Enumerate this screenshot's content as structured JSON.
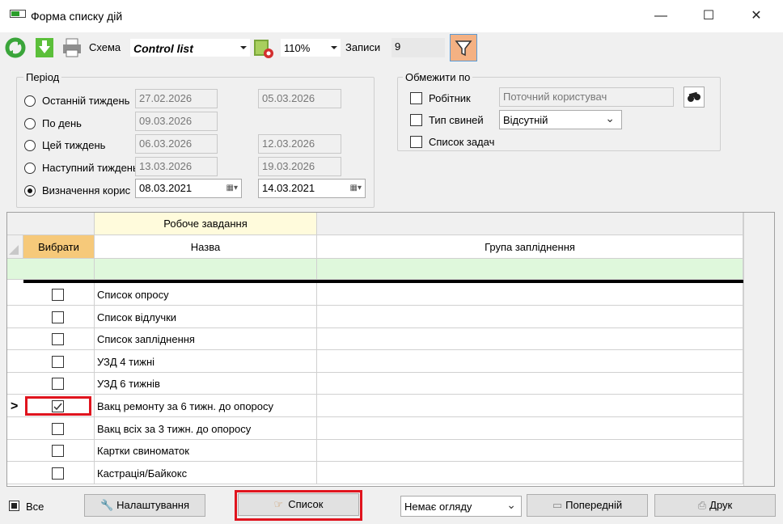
{
  "window": {
    "title": "Форма списку дій",
    "minimize": "—",
    "maximize": "☐",
    "close": "✕"
  },
  "toolbar": {
    "scheme_label": "Схема",
    "scheme_value": "Control list",
    "zoom_value": "110%",
    "records_label": "Записи",
    "records_value": "9",
    "icons": [
      "refresh-icon",
      "export-icon",
      "print-icon",
      "scheme-settings-icon",
      "filter-icon"
    ]
  },
  "period": {
    "title": "Період",
    "options": [
      {
        "label": "Останній тиждень",
        "from": "27.02.2026",
        "to": "05.03.2026",
        "selected": false
      },
      {
        "label": "По день",
        "from": "09.03.2026",
        "to": "",
        "selected": false
      },
      {
        "label": "Цей тиждень",
        "from": "06.03.2026",
        "to": "12.03.2026",
        "selected": false
      },
      {
        "label": "Наступний тиждень",
        "from": "13.03.2026",
        "to": "19.03.2026",
        "selected": false
      },
      {
        "label": "Визначення корис",
        "from": "08.03.2021",
        "to": "14.03.2021",
        "selected": true
      }
    ]
  },
  "limit": {
    "title": "Обмежити по",
    "worker_label": "Робітник",
    "worker_value": "Поточний користувач",
    "pig_type_label": "Тип свиней",
    "pig_type_value": "Відсутній",
    "task_list_label": "Список задач"
  },
  "grid": {
    "group_header": "Робоче завдання",
    "col_select": "Вибрати",
    "col_name": "Назва",
    "col_group": "Група запліднення",
    "current_row_marker": ">",
    "rows": [
      {
        "name": "Список опросу",
        "checked": false
      },
      {
        "name": "Список відлучки",
        "checked": false
      },
      {
        "name": "Список запліднення",
        "checked": false
      },
      {
        "name": "УЗД 4 тижні",
        "checked": false
      },
      {
        "name": "УЗД 6 тижнів",
        "checked": false
      },
      {
        "name": "Вакц ремонту за 6 тижн. до опоросу",
        "checked": true
      },
      {
        "name": "Вакц всіх за 3 тижн. до опоросу",
        "checked": false
      },
      {
        "name": "Картки свиноматок",
        "checked": false
      },
      {
        "name": "Кастрація/Байкокс",
        "checked": false
      }
    ]
  },
  "bottom": {
    "all_label": "Все",
    "settings_button": "Налаштування",
    "list_button": "Список",
    "view_select": "Немає огляду",
    "previous_button": "Попередній",
    "print_button": "Друк"
  },
  "colors": {
    "group_header_bg": "#fffbdc",
    "select_header_bg": "#f6c97a",
    "filter_row_bg": "#dff8dc",
    "highlight": "#e0141e",
    "filter_button_bg": "#f4b183"
  }
}
